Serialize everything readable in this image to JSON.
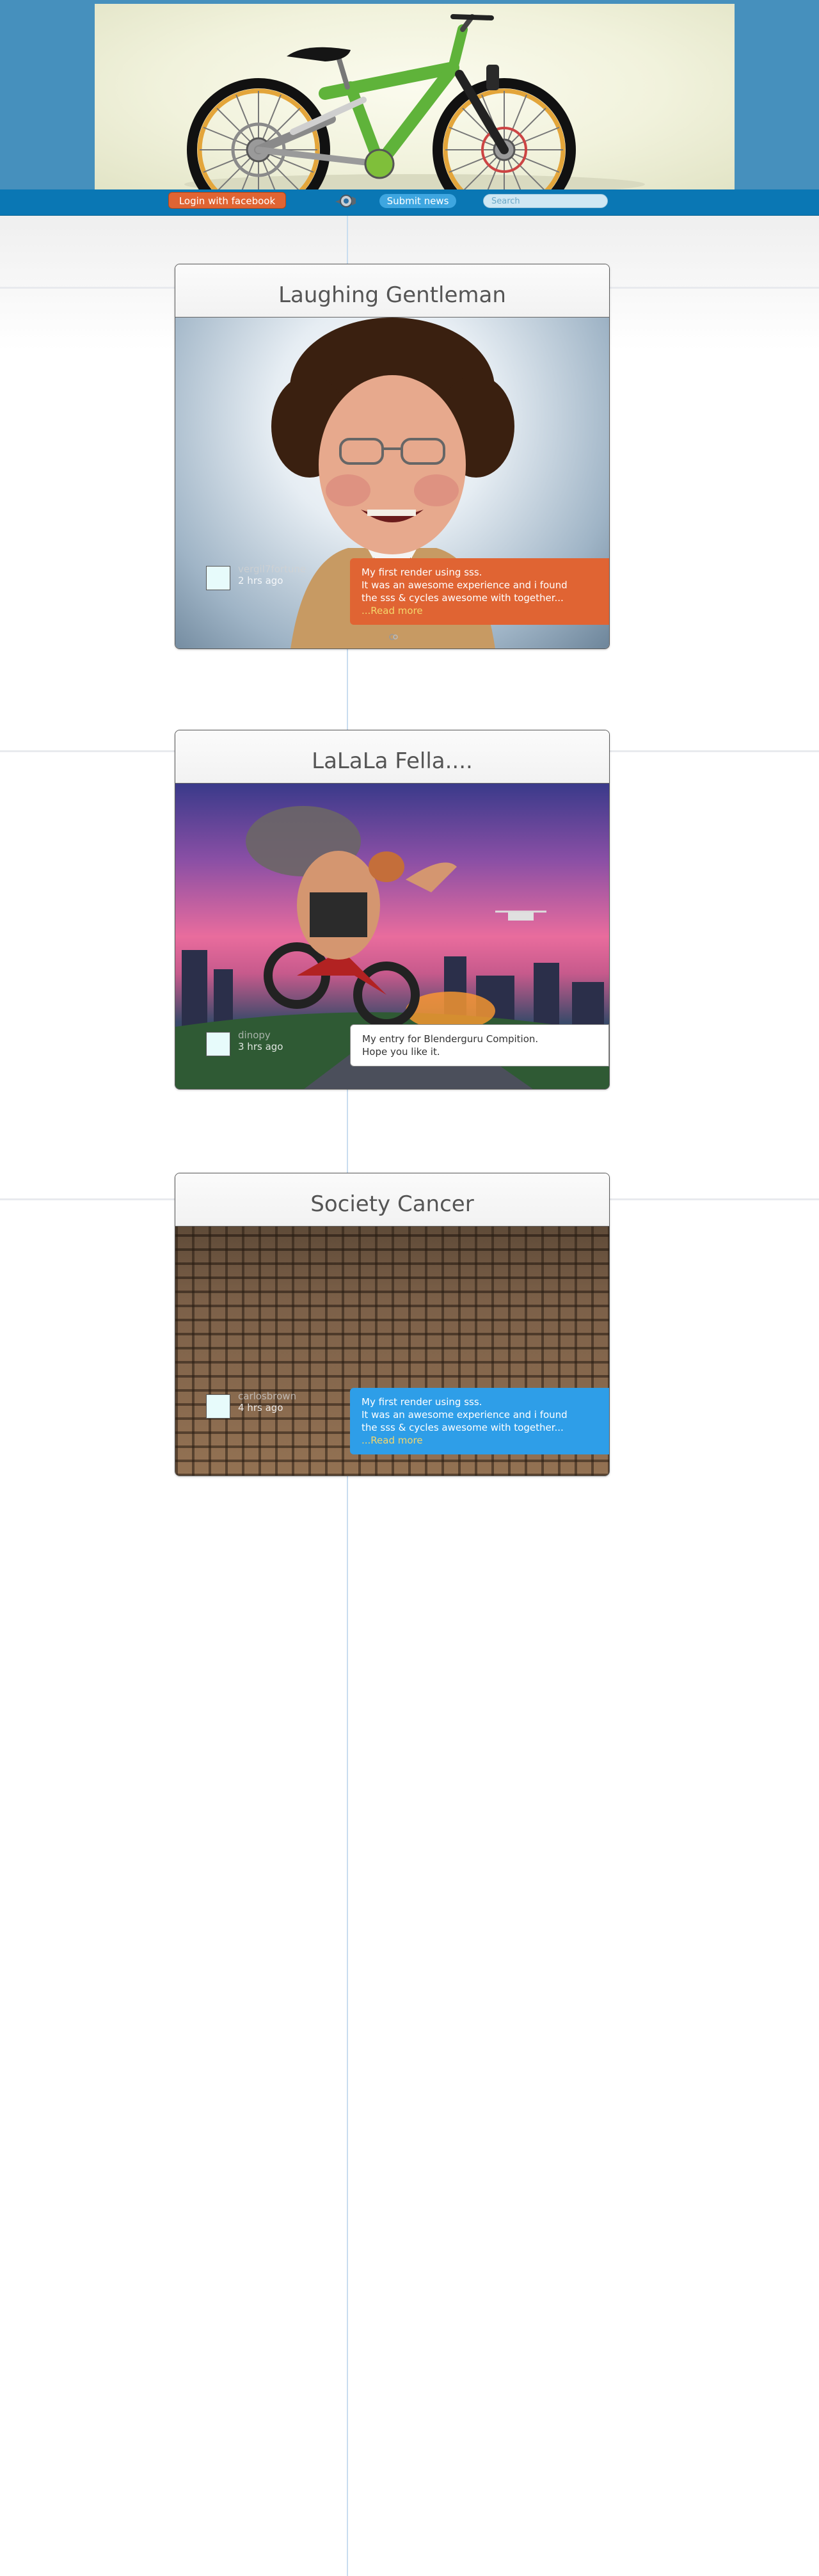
{
  "header": {
    "login_label": "Login with facebook",
    "submit_label": "Submit news",
    "search_placeholder": "Search"
  },
  "posts": [
    {
      "title": "Laughing Gentleman",
      "user": "vergil7fortune",
      "time": "2 hrs ago",
      "desc_lines": [
        "My first render using sss.",
        "It was an awesome experience and i found",
        "the sss & cycles awesome with together..."
      ],
      "read_more": "...Read more",
      "desc_color": "#e06433"
    },
    {
      "title": "LaLaLa Fella....",
      "user": "dinopy",
      "time": "3 hrs ago",
      "desc_lines": [
        "My entry for Blenderguru Compition.",
        "Hope you like it."
      ],
      "desc_color": "#ffffff"
    },
    {
      "title": "Society Cancer",
      "user": "carlosbrown",
      "time": "4 hrs ago",
      "desc_lines": [
        "My first render using sss.",
        "It was an awesome experience and i found",
        "the sss & cycles awesome with together..."
      ],
      "read_more": "...Read more",
      "desc_color": "#2e9ee8"
    }
  ]
}
